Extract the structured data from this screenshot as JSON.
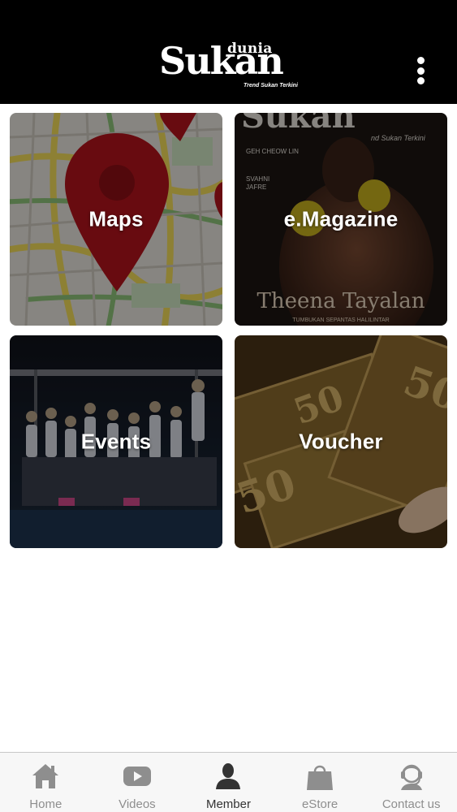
{
  "header": {
    "logo_top": "dunia",
    "logo_main": "Sukan",
    "logo_tagline": "Trend Sukan Terkini",
    "menu_icon": "more-vertical-icon"
  },
  "tiles": [
    {
      "label": "Maps",
      "image": "map-with-location-pin"
    },
    {
      "label": "e.Magazine",
      "image": "magazine-cover-boxer",
      "cover": {
        "masthead": "Sukan",
        "tagline": "nd Sukan Terkini",
        "name_1": "GEH CHEOW LIN",
        "name_2": "SVAHNI",
        "name_3": "JAFRE",
        "cover_name": "Theena Tayalan",
        "cover_sub": "TUMBUKAN SEPANTAS HALILINTAR"
      }
    },
    {
      "label": "Events",
      "image": "runners-at-start-line"
    },
    {
      "label": "Voucher",
      "image": "discount-vouchers",
      "voucher_text": "50"
    }
  ],
  "tabbar": {
    "active": "Member",
    "items": [
      {
        "label": "Home",
        "icon": "home-icon"
      },
      {
        "label": "Videos",
        "icon": "video-play-icon"
      },
      {
        "label": "Member",
        "icon": "user-icon"
      },
      {
        "label": "eStore",
        "icon": "shopping-bag-icon"
      },
      {
        "label": "Contact us",
        "icon": "support-agent-icon"
      }
    ]
  },
  "colors": {
    "header_bg": "#000000",
    "page_bg": "#ffffff",
    "tab_inactive": "#8e8e8e",
    "tab_active": "#333333",
    "map_pin": "#b3141c"
  }
}
